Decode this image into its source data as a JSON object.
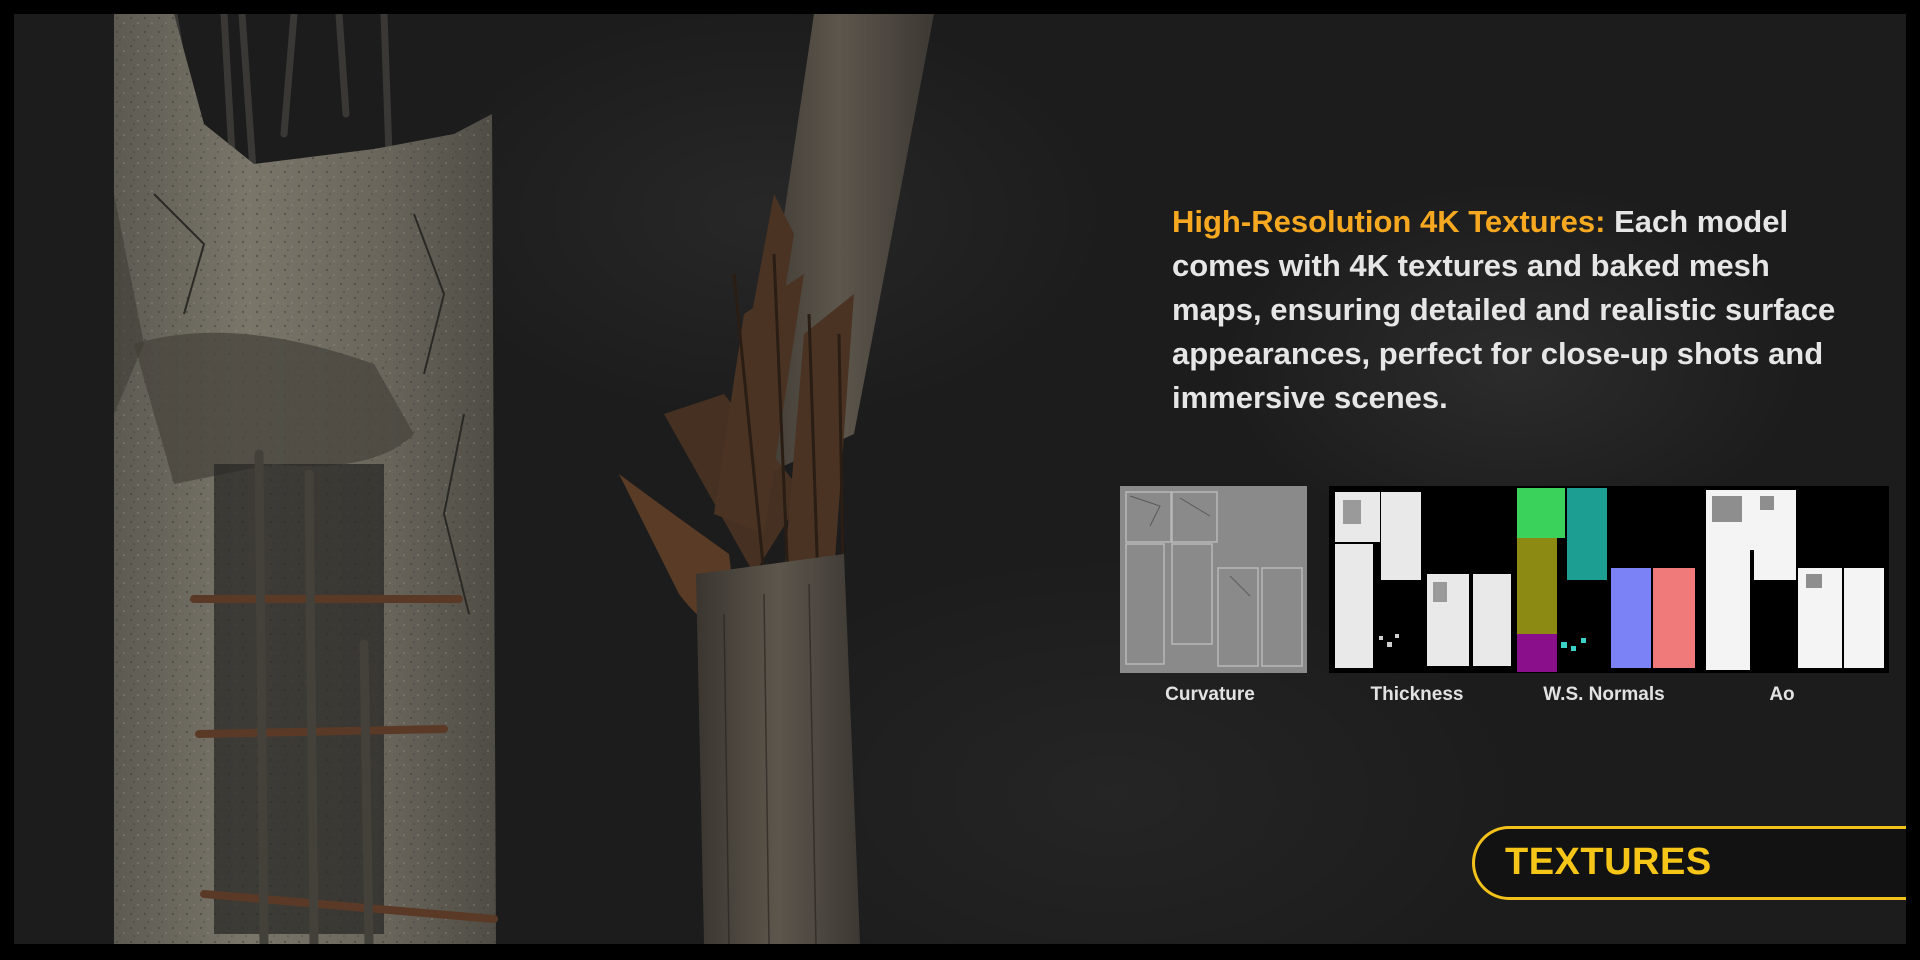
{
  "headline": {
    "highlight": "High-Resolution 4K Textures:",
    "body": " Each model comes with 4K textures and baked mesh maps, ensuring detailed and realistic surface appearances, perfect for close-up shots and immersive scenes."
  },
  "maps": [
    {
      "label": "Curvature"
    },
    {
      "label": "Thickness"
    },
    {
      "label": "W.S. Normals"
    },
    {
      "label": "Ao"
    }
  ],
  "badge": {
    "label": "TEXTURES"
  },
  "colors": {
    "accent_orange": "#f5a820",
    "badge_yellow": "#f5c518",
    "background": "#1c1c1c",
    "frame": "#000000"
  }
}
